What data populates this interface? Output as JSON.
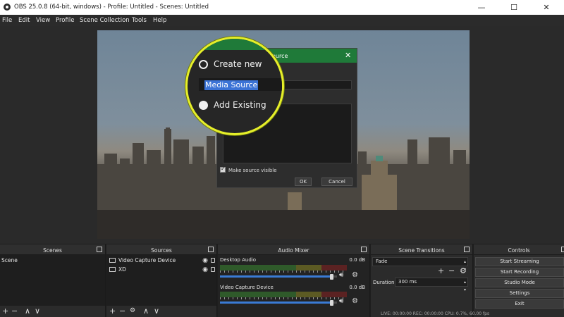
{
  "window": {
    "title": "OBS 25.0.8 (64-bit, windows) - Profile: Untitled - Scenes: Untitled",
    "minimize": "—",
    "maximize": "☐",
    "close": "✕"
  },
  "menu": [
    "File",
    "Edit",
    "View",
    "Profile",
    "Scene Collection",
    "Tools",
    "Help"
  ],
  "dialog": {
    "title_fragment": "ource",
    "close": "✕",
    "make_visible_label": "Make source visible",
    "ok_label": "OK",
    "cancel_label": "Cancel",
    "accent_color": "#1f7a39"
  },
  "magnifier": {
    "create_new_label": "Create new",
    "name_value": "Media Source",
    "add_existing_label": "Add Existing",
    "ring_color": "#e6ef2a"
  },
  "docks": {
    "scenes": {
      "title": "Scenes",
      "items": [
        "Scene"
      ],
      "toolbar": [
        "+",
        "−",
        "∧",
        "∨"
      ]
    },
    "sources": {
      "title": "Sources",
      "items": [
        "Video Capture Device",
        "XD"
      ],
      "toolbar": [
        "+",
        "−",
        "⚙",
        "∧",
        "∨"
      ]
    },
    "mixer": {
      "title": "Audio Mixer",
      "channels": [
        {
          "name": "Desktop Audio",
          "db": "0.0 dB",
          "volume": 0.97
        },
        {
          "name": "Video Capture Device",
          "db": "0.0 dB",
          "volume": 0.97
        }
      ]
    },
    "transitions": {
      "title": "Scene Transitions",
      "selected": "Fade",
      "duration_label": "Duration",
      "duration_value": "300 ms",
      "toolbar": [
        "+",
        "−",
        "⚙"
      ]
    },
    "controls": {
      "title": "Controls",
      "buttons": [
        "Start Streaming",
        "Start Recording",
        "Studio Mode",
        "Settings",
        "Exit"
      ]
    }
  },
  "status": {
    "text": "LIVE: 00:00:00   REC: 00:00:00   CPU: 0.7%, 60.00 fps"
  }
}
